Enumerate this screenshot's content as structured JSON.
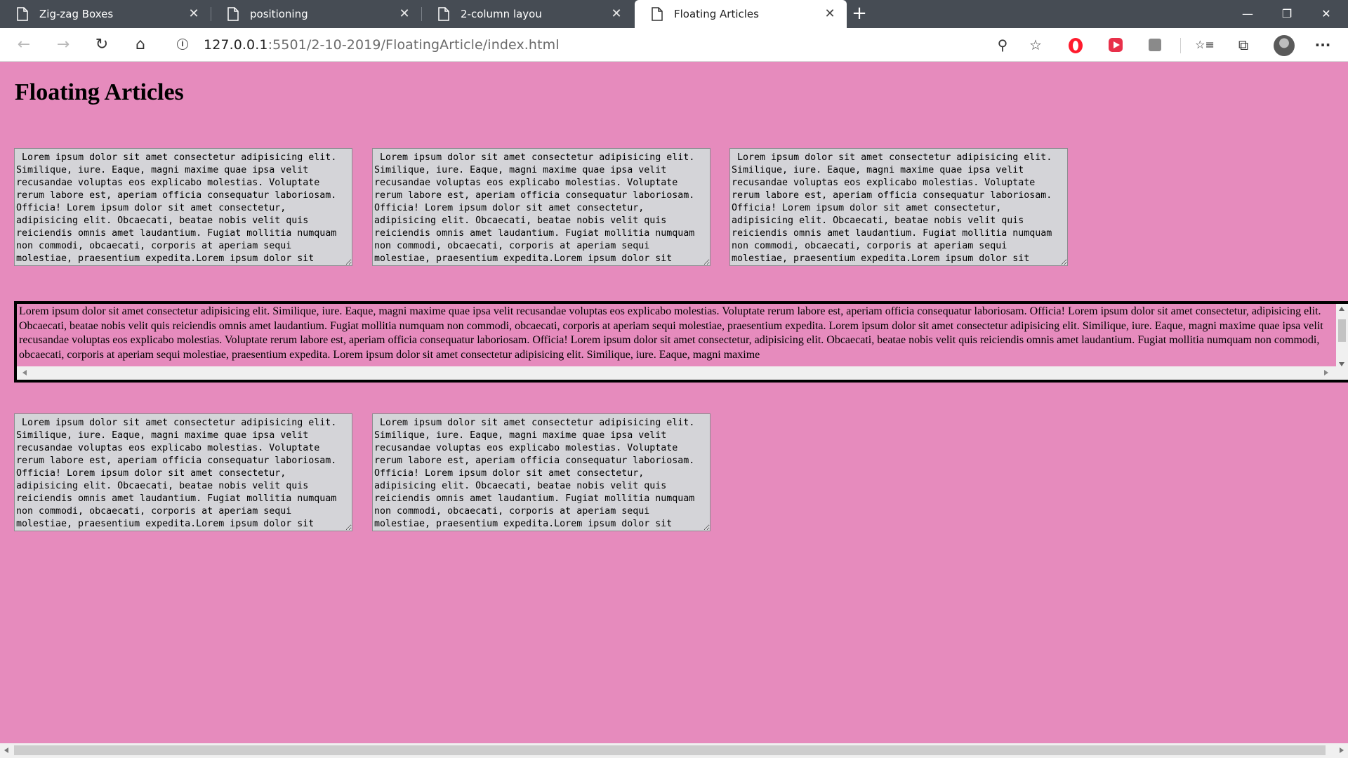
{
  "browser": {
    "tabs": [
      {
        "title": "Zig-zag Boxes",
        "active": false
      },
      {
        "title": "positioning",
        "active": false
      },
      {
        "title": "2-column layou",
        "active": false
      },
      {
        "title": "Floating Articles",
        "active": true
      }
    ],
    "new_tab_symbol": "+",
    "window_controls": {
      "minimize": "—",
      "restore": "❐",
      "close": "✕"
    },
    "url_host": "127.0.0.1",
    "url_rest": ":5501/2-10-2019/FloatingArticle/index.html",
    "nav": {
      "back": "←",
      "forward": "→",
      "reload": "↻",
      "home": "⌂"
    },
    "toolbar_icons": {
      "zoom": "⚲",
      "favorite": "☆",
      "favorites_list": "☆≡",
      "collections": "⧉",
      "more": "···"
    }
  },
  "page": {
    "heading": "Floating Articles",
    "article_text": " Lorem ipsum dolor sit amet consectetur adipisicing elit. Similique, iure. Eaque, magni maxime quae ipsa velit recusandae voluptas eos explicabo molestias. Voluptate rerum labore est, aperiam officia consequatur laboriosam. Officia! Lorem ipsum dolor sit amet consectetur, adipisicing elit. Obcaecati, beatae nobis velit quis reiciendis omnis amet laudantium. Fugiat mollitia numquam non commodi, obcaecati, corporis at aperiam sequi molestiae, praesentium expedita.Lorem ipsum dolor sit",
    "wide_text": "Lorem ipsum dolor sit amet consectetur adipisicing elit. Similique, iure. Eaque, magni maxime quae ipsa velit recusandae voluptas eos explicabo molestias. Voluptate rerum labore est, aperiam officia consequatur laboriosam. Officia! Lorem ipsum dolor sit amet consectetur, adipisicing elit. Obcaecati, beatae nobis velit quis reiciendis omnis amet laudantium. Fugiat mollitia numquam non commodi, obcaecati, corporis at aperiam sequi molestiae, praesentium expedita. Lorem ipsum dolor sit amet consectetur adipisicing elit. Similique, iure. Eaque, magni maxime quae ipsa velit recusandae voluptas eos explicabo molestias. Voluptate rerum labore est, aperiam officia consequatur laboriosam. Officia! Lorem ipsum dolor sit amet consectetur, adipisicing elit. Obcaecati, beatae nobis velit quis reiciendis omnis amet laudantium. Fugiat mollitia numquam non commodi, obcaecati, corporis at aperiam sequi molestiae, praesentium expedita. Lorem ipsum dolor sit amet consectetur adipisicing elit. Similique, iure. Eaque, magni maxime"
  },
  "colors": {
    "page_background": "#e68bbd",
    "textarea_background": "#d4d4d8",
    "titlebar": "#464c54"
  }
}
